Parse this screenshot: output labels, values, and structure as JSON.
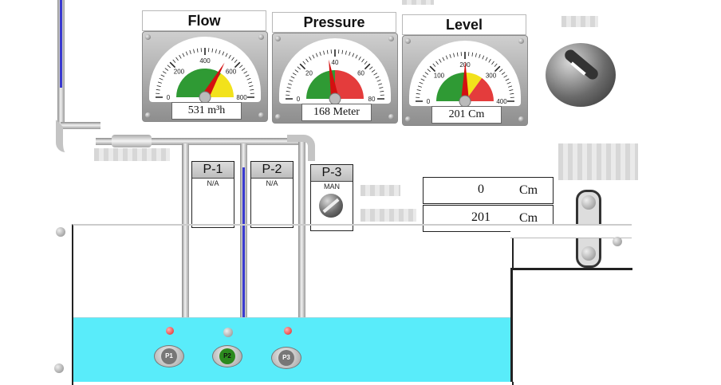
{
  "gauges": [
    {
      "id": "flow",
      "title": "Flow",
      "ticks": [
        "0",
        "200",
        "400",
        "600",
        "800"
      ],
      "min": 0,
      "max": 800,
      "value": 531,
      "readout": "531 m³h",
      "green_zone": [
        0,
        550
      ],
      "yellow_zone": [
        550,
        800
      ],
      "red_zone": [
        800,
        800
      ]
    },
    {
      "id": "pressure",
      "title": "Pressure",
      "ticks": [
        "0",
        "20",
        "40",
        "60",
        "80"
      ],
      "min": 0,
      "max": 80,
      "value": 36,
      "readout": "168 Meter",
      "green_zone": [
        0,
        40
      ],
      "yellow_zone": [
        40,
        40
      ],
      "red_zone": [
        40,
        80
      ]
    },
    {
      "id": "level",
      "title": "Level",
      "ticks": [
        "0",
        "100",
        "200",
        "300",
        "400"
      ],
      "min": 0,
      "max": 400,
      "value": 201,
      "readout": "201 Cm",
      "green_zone": [
        0,
        200
      ],
      "yellow_zone": [
        200,
        280
      ],
      "red_zone": [
        280,
        400
      ]
    }
  ],
  "pumps": [
    {
      "label": "P-1",
      "status": "N/A",
      "icon_label": "P1",
      "running": false
    },
    {
      "label": "P-2",
      "status": "N/A",
      "icon_label": "P2",
      "running": true
    },
    {
      "label": "P-3",
      "status": "MAN",
      "icon_label": "P3",
      "running": false
    }
  ],
  "level_display": {
    "row1_value": "0",
    "row1_unit": "Cm",
    "row2_value": "201",
    "row2_unit": "Cm"
  },
  "colors": {
    "water": "#59ecfa",
    "gauge_green": "#2f9a34",
    "gauge_yellow": "#f2e21b",
    "gauge_red": "#e43c3c",
    "needle": "#d41010",
    "flow_blue": "#3a3ad0",
    "pump_running": "#2c8a1e"
  },
  "icons": [
    "main-selector-knob-icon",
    "p3-selector-knob-icon",
    "pump-icon",
    "alarm-led-icon"
  ]
}
